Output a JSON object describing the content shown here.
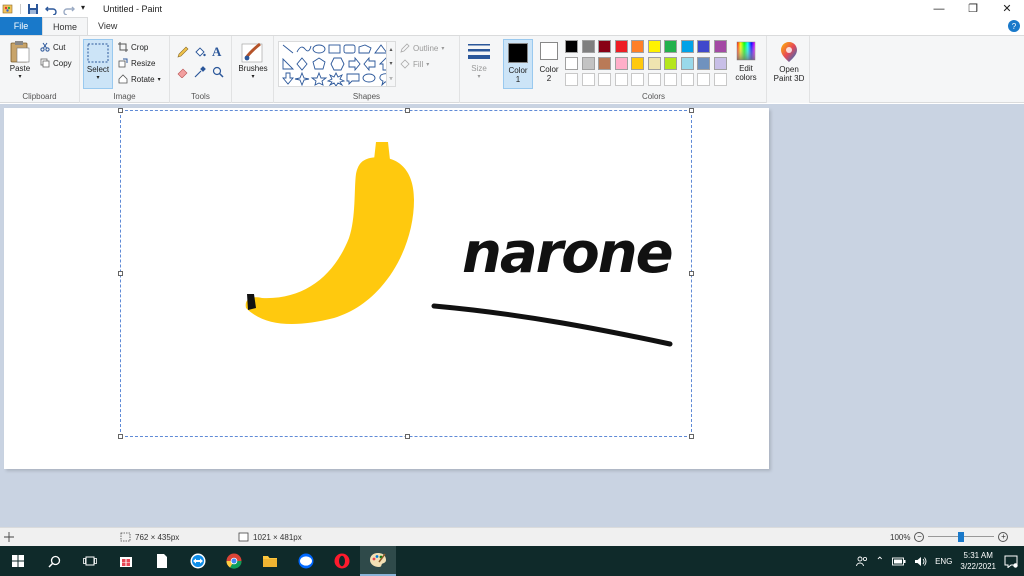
{
  "title": "Untitled - Paint",
  "tabs": {
    "file": "File",
    "home": "Home",
    "view": "View"
  },
  "clipboard": {
    "paste": "Paste",
    "cut": "Cut",
    "copy": "Copy",
    "label": "Clipboard"
  },
  "image": {
    "select": "Select",
    "crop": "Crop",
    "resize": "Resize",
    "rotate": "Rotate",
    "label": "Image"
  },
  "tools": {
    "label": "Tools"
  },
  "brushes": {
    "label": "Brushes"
  },
  "shapes": {
    "outline": "Outline",
    "fill": "Fill",
    "label": "Shapes"
  },
  "size": {
    "label": "Size"
  },
  "colors": {
    "color1_label": "Color",
    "color1_num": "1",
    "color2_label": "Color",
    "color2_num": "2",
    "edit_label": "Edit",
    "edit_label2": "colors",
    "label": "Colors",
    "palette_row1": [
      "#000000",
      "#7f7f7f",
      "#880015",
      "#ed1c24",
      "#ff7f27",
      "#fff200",
      "#22b14c",
      "#00a2e8",
      "#3f48cc",
      "#a349a4"
    ],
    "palette_row2": [
      "#ffffff",
      "#c3c3c3",
      "#b97a57",
      "#ffaec9",
      "#ffc90e",
      "#efe4b0",
      "#b5e61d",
      "#99d9ea",
      "#7092be",
      "#c8bfe7"
    ],
    "palette_row3": [
      "#ffffff",
      "#ffffff",
      "#ffffff",
      "#ffffff",
      "#ffffff",
      "#ffffff",
      "#ffffff",
      "#ffffff",
      "#ffffff",
      "#ffffff"
    ]
  },
  "paint3d": {
    "label1": "Open",
    "label2": "Paint 3D"
  },
  "canvas_text": "narone",
  "status": {
    "selection_size": "762 × 435px",
    "image_size": "1021 × 481px",
    "zoom": "100%"
  },
  "taskbar": {
    "lang": "ENG",
    "time": "5:31 AM",
    "date": "3/22/2021"
  }
}
